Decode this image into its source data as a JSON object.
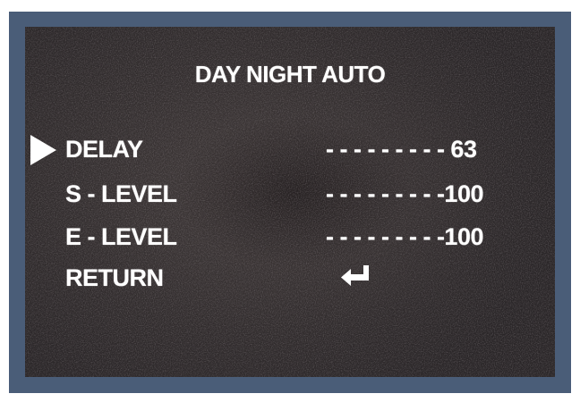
{
  "menu": {
    "title": "DAY NIGHT AUTO",
    "items": [
      {
        "label": "DELAY",
        "value": "- - - - - - - - - 63",
        "selected": true
      },
      {
        "label": "S - LEVEL",
        "value": "- - - - - - - - -100",
        "selected": false
      },
      {
        "label": "E - LEVEL",
        "value": "- - - - - - - - -100",
        "selected": false
      },
      {
        "label": "RETURN",
        "icon": "return-arrow-icon",
        "selected": false
      }
    ]
  },
  "colors": {
    "frame": "#4a5d78",
    "screen_background": "#322d2e",
    "text": "#ffffff"
  }
}
